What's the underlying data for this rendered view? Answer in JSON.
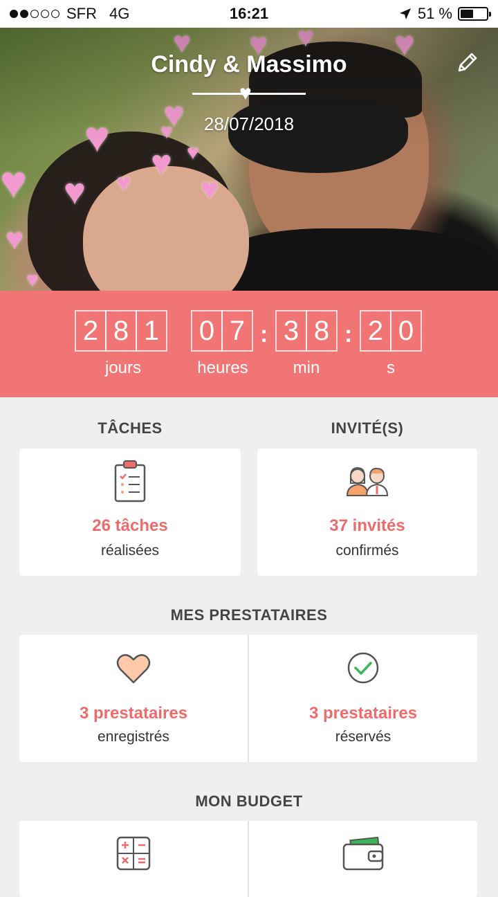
{
  "status_bar": {
    "carrier": "SFR",
    "network": "4G",
    "time": "16:21",
    "battery": "51 %",
    "battery_level": 0.51,
    "signal_bars_filled": 2,
    "signal_bars_total": 5
  },
  "hero": {
    "couple_name": "Cindy & Massimo",
    "wedding_date": "28/07/2018",
    "edit_icon": "pencil-icon"
  },
  "countdown": {
    "days": [
      "2",
      "8",
      "1"
    ],
    "hours": [
      "0",
      "7"
    ],
    "minutes": [
      "3",
      "8"
    ],
    "seconds": [
      "2",
      "0"
    ],
    "separator": ":",
    "labels": {
      "days": "jours",
      "hours": "heures",
      "minutes": "min",
      "seconds": "s"
    }
  },
  "tasks": {
    "title": "TÂCHES",
    "count_text": "26 tâches",
    "sub_text": "réalisées",
    "icon": "clipboard-checklist-icon"
  },
  "guests": {
    "title": "INVITÉ(S)",
    "count_text": "37 invités",
    "sub_text": "confirmés",
    "icon": "couple-guests-icon"
  },
  "vendors": {
    "title": "MES PRESTATAIRES",
    "saved": {
      "count_text": "3 prestataires",
      "sub_text": "enregistrés",
      "icon": "heart-icon"
    },
    "booked": {
      "count_text": "3 prestataires",
      "sub_text": "réservés",
      "icon": "check-circle-icon"
    }
  },
  "budget": {
    "title": "MON BUDGET",
    "left_icon": "calculator-icon",
    "right_icon": "wallet-icon"
  },
  "colors": {
    "accent": "#f27575",
    "accent_text": "#ef6b6b",
    "background": "#efefef"
  }
}
